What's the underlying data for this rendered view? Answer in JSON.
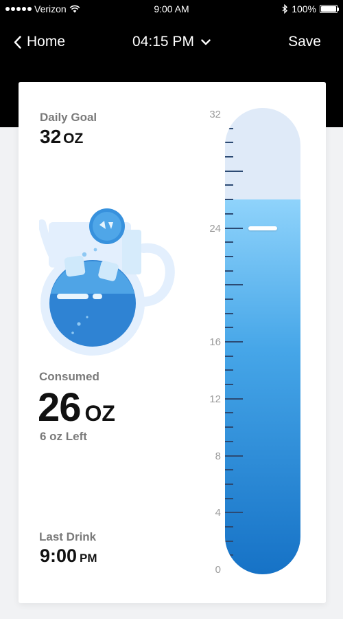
{
  "status_bar": {
    "carrier": "Verizon",
    "time": "9:00 AM",
    "battery": "100%",
    "icons": [
      "signal-dots-icon",
      "wifi-icon",
      "bluetooth-icon",
      "battery-icon"
    ]
  },
  "nav": {
    "back_label": "Home",
    "title": "04:15 PM",
    "save_label": "Save"
  },
  "goal": {
    "label": "Daily Goal",
    "value": "32",
    "unit": "OZ"
  },
  "consumed": {
    "label": "Consumed",
    "value": "26",
    "unit": "OZ",
    "left_text": "6 oz Left"
  },
  "last_drink": {
    "label": "Last Drink",
    "time": "9:00",
    "ampm": "PM"
  },
  "gauge": {
    "max_oz": 32,
    "filled_oz": 26,
    "goal_marker_oz": 24,
    "tick_labels": [
      "32",
      "24",
      "16",
      "12",
      "8",
      "4",
      "0"
    ],
    "tick_label_values": [
      32,
      24,
      16,
      12,
      8,
      4,
      0
    ],
    "colors": {
      "empty": "#dfeaf8",
      "fill_top": "#8fd3fb",
      "fill_bottom": "#1672c6",
      "ticks": "#2c4a73"
    }
  }
}
